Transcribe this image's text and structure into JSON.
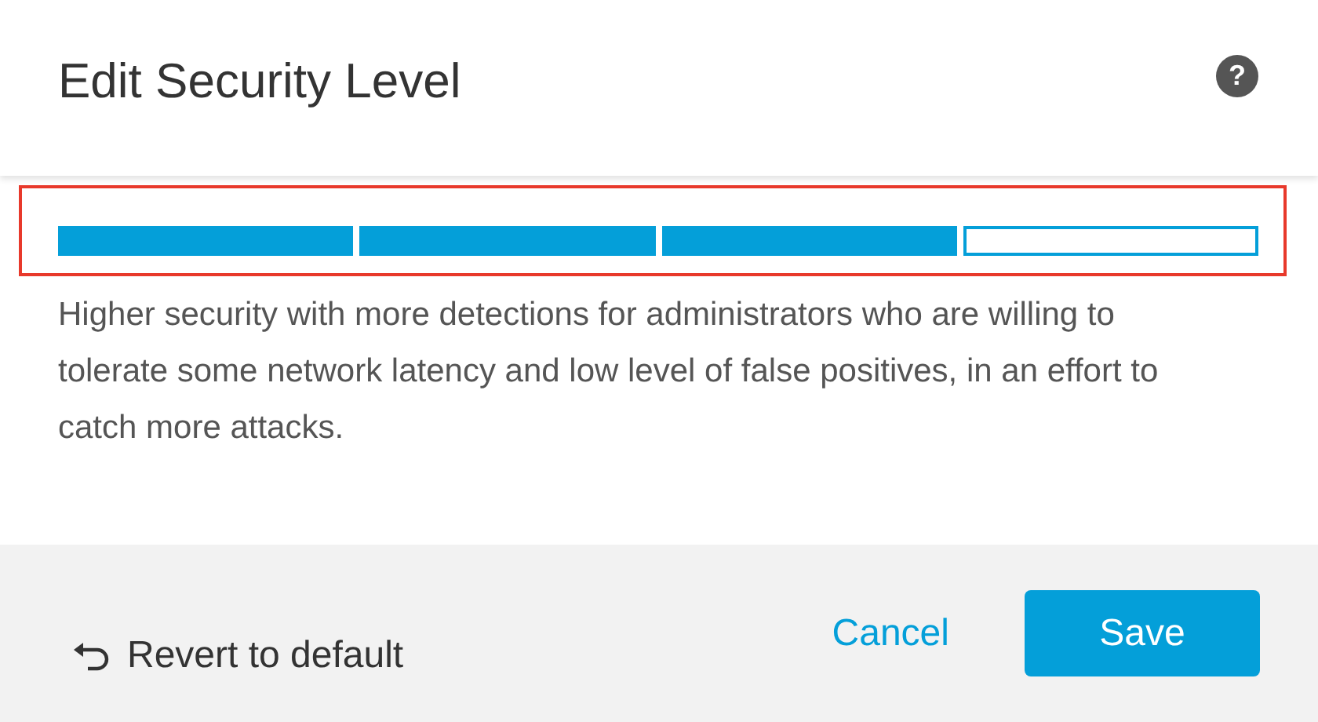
{
  "dialog": {
    "title": "Edit Security Level",
    "help_icon": "?"
  },
  "security_level": {
    "highlighted": true,
    "segments": [
      {
        "filled": true
      },
      {
        "filled": true
      },
      {
        "filled": true
      },
      {
        "filled": false
      }
    ]
  },
  "description": "Higher security with more detections for administrators who are willing to tolerate some network latency and low level of false positives, in an effort to catch more attacks.",
  "footer": {
    "revert": "Revert to default",
    "cancel": "Cancel",
    "save": "Save"
  }
}
